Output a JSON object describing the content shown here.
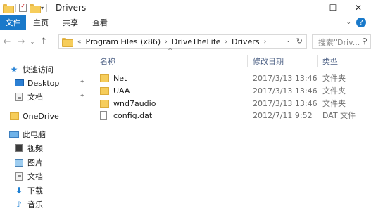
{
  "window": {
    "title": "Drivers",
    "controls": {
      "minimize": "—",
      "maximize": "☐",
      "close": "✕"
    }
  },
  "ribbon": {
    "tabs": [
      "文件",
      "主页",
      "共享",
      "查看"
    ],
    "expand_glyph": "⌄",
    "help_glyph": "?"
  },
  "nav": {
    "back_glyph": "←",
    "forward_glyph": "→",
    "recent_glyph": "⌄",
    "up_glyph": "↑",
    "overflow_glyph": "«",
    "breadcrumbs": [
      "Program Files (x86)",
      "DriveTheLife",
      "Drivers"
    ],
    "crumb_separator": "›",
    "address_dropdown_glyph": "⌄",
    "refresh_glyph": "↻",
    "search_placeholder": "搜索\"Driv...",
    "search_glyph": "⚲"
  },
  "sidebar": {
    "quick_access": "快速访问",
    "pinned": [
      "Desktop",
      "文档"
    ],
    "pin_glyph": "📌",
    "onedrive": "OneDrive",
    "this_pc": "此电脑",
    "pc_items": [
      "视频",
      "图片",
      "文档",
      "下载",
      "音乐"
    ]
  },
  "columns": {
    "name": "名称",
    "date": "修改日期",
    "type": "类型",
    "sort_glyph": "^"
  },
  "files": [
    {
      "name": "Net",
      "date": "2017/3/13 13:46",
      "type": "文件夹",
      "icon": "folder-icon"
    },
    {
      "name": "UAA",
      "date": "2017/3/13 13:46",
      "type": "文件夹",
      "icon": "folder-icon"
    },
    {
      "name": "wnd7audio",
      "date": "2017/3/13 13:46",
      "type": "文件夹",
      "icon": "folder-icon"
    },
    {
      "name": "config.dat",
      "date": "2012/7/11 9:52",
      "type": "DAT 文件",
      "icon": "file-icon"
    }
  ],
  "colors": {
    "accent": "#1979ca",
    "folder": "#f6cd5b",
    "header_text": "#4d6185"
  }
}
